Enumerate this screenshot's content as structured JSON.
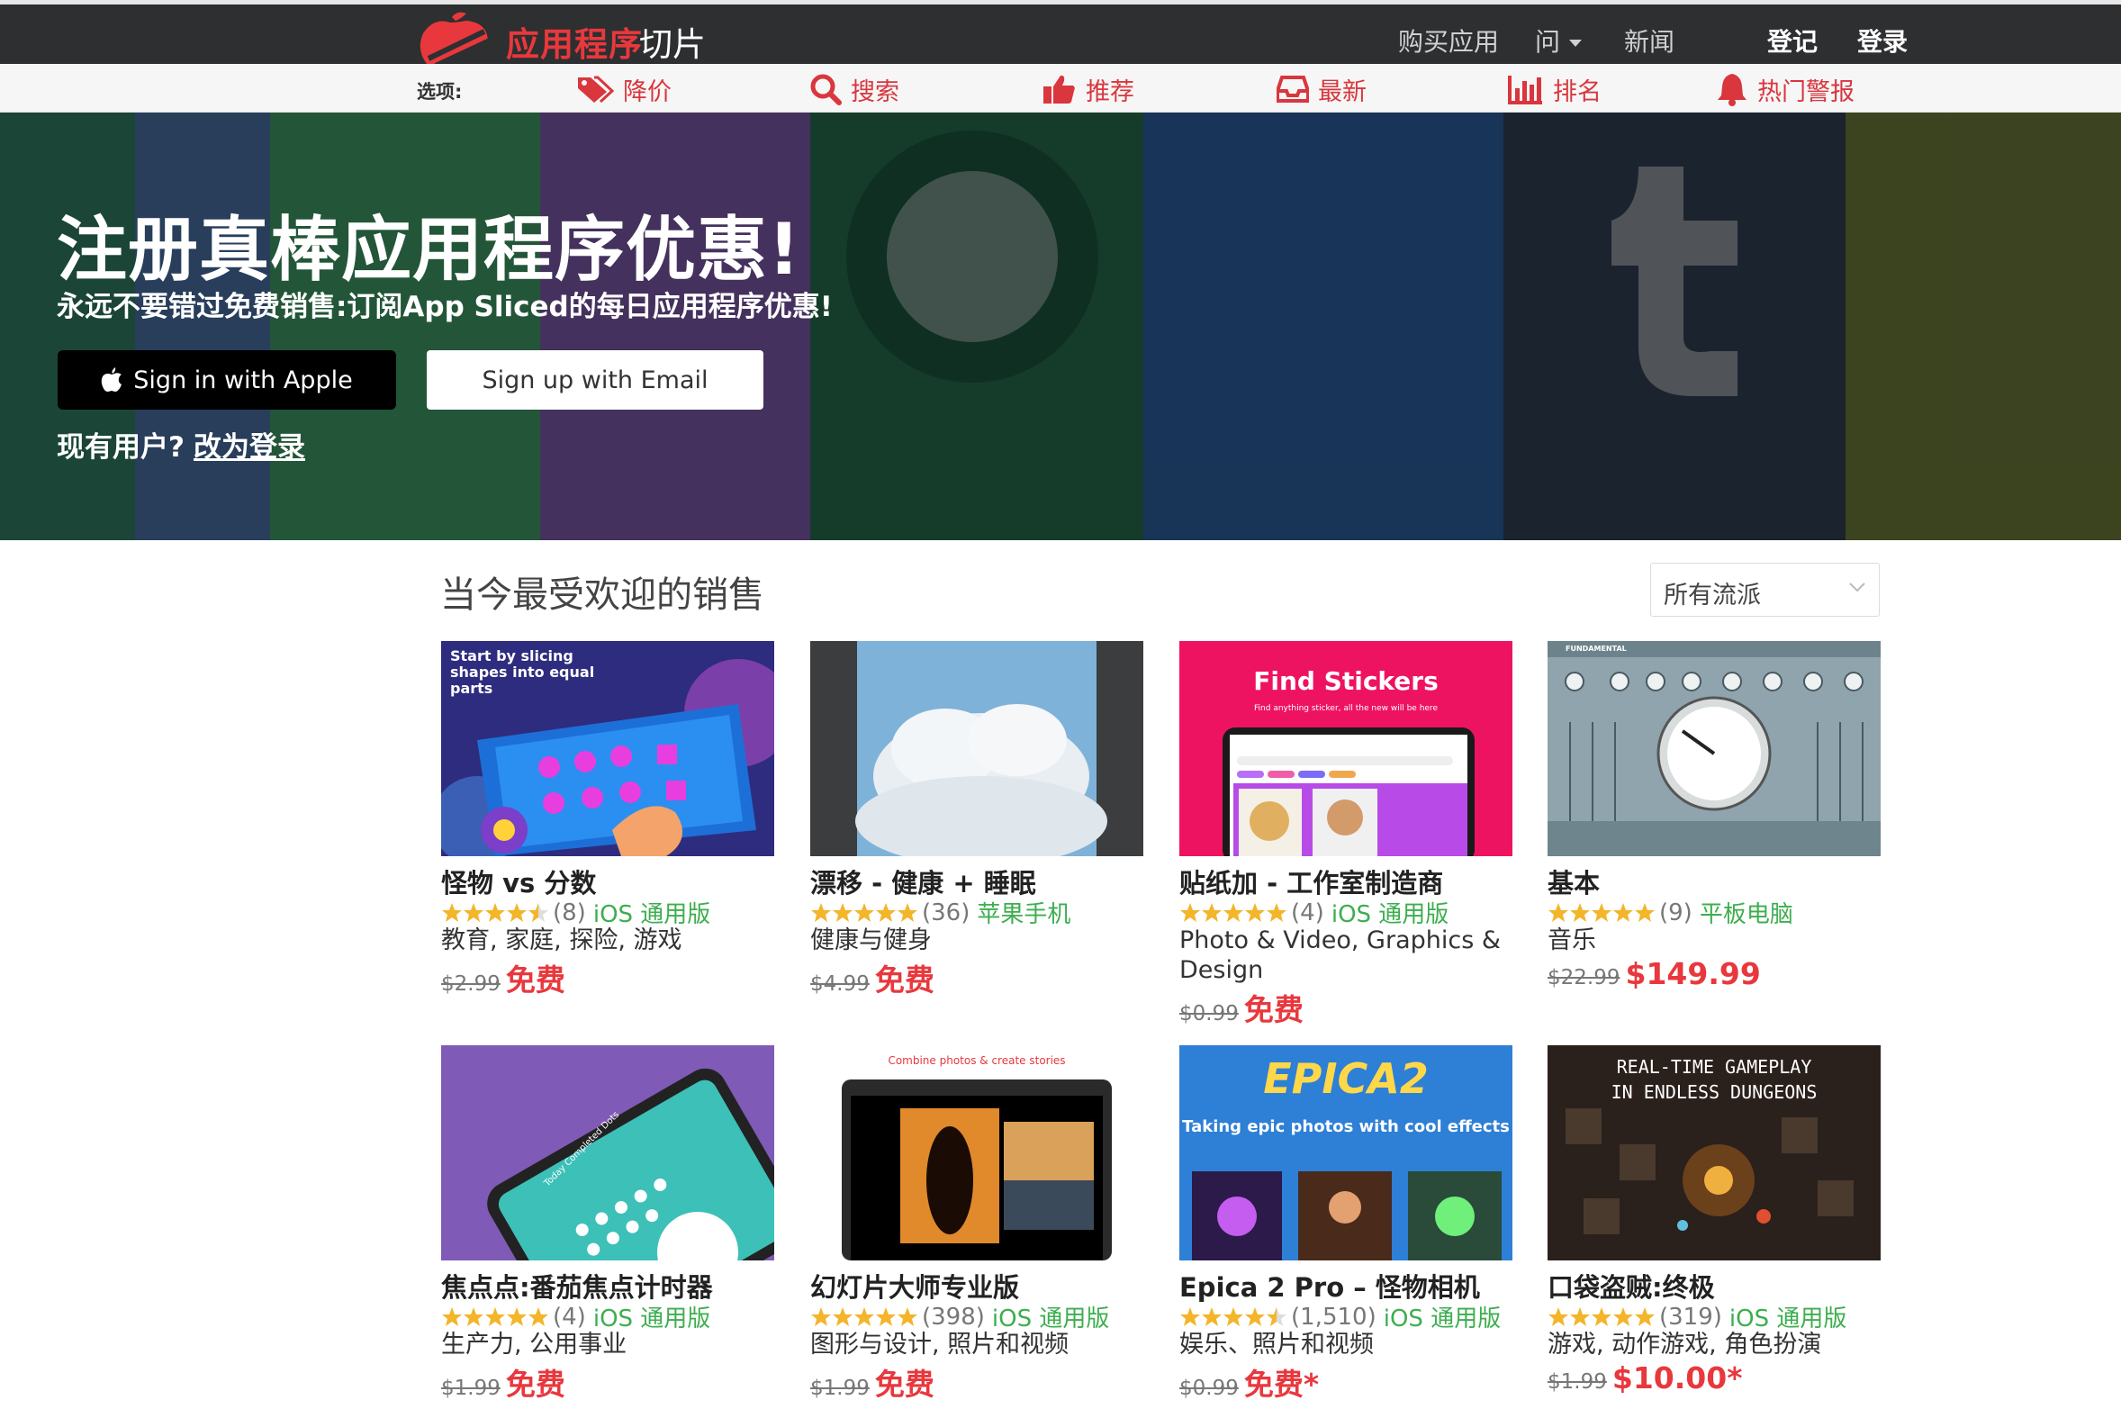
{
  "header": {
    "brand_red": "应用程序",
    "brand_white": "切片",
    "nav": {
      "buy": "购买应用",
      "ask": "问",
      "news": "新闻",
      "register": "登记",
      "login": "登录"
    }
  },
  "options": {
    "label": "选项:",
    "items": [
      {
        "label": "降价",
        "icon": "price-tag-icon"
      },
      {
        "label": "搜索",
        "icon": "search-icon"
      },
      {
        "label": "推荐",
        "icon": "thumbs-up-icon"
      },
      {
        "label": "最新",
        "icon": "inbox-icon"
      },
      {
        "label": "排名",
        "icon": "bar-chart-icon"
      },
      {
        "label": "热门警报",
        "icon": "bell-icon"
      }
    ]
  },
  "hero": {
    "title": "注册真棒应用程序优惠!",
    "subtitle": "永远不要错过免费销售:订阅App Sliced的每日应用程序优惠!",
    "apple_button": "Sign in with Apple",
    "email_button": "Sign up with Email",
    "existing_user": "现有用户?",
    "login_instead": "改为登录"
  },
  "section": {
    "title": "当今最受欢迎的销售",
    "genre_select": "所有流派"
  },
  "apps": [
    {
      "name": "怪物 vs 分数",
      "rating_count": "(8)",
      "platform": "iOS 通用版",
      "categories": "教育, 家庭, 探险, 游戏",
      "old_price": "$2.99",
      "new_price": "免费",
      "stars": 4.5
    },
    {
      "name": "漂移 - 健康 + 睡眠",
      "rating_count": "(36)",
      "platform": "苹果手机",
      "categories": "健康与健身",
      "old_price": "$4.99",
      "new_price": "免费",
      "stars": 5
    },
    {
      "name": "贴纸加 - 工作室制造商",
      "rating_count": "(4)",
      "platform": "iOS 通用版",
      "categories": "Photo & Video, Graphics & Design",
      "old_price": "$0.99",
      "new_price": "免费",
      "stars": 5
    },
    {
      "name": "基本",
      "rating_count": "(9)",
      "platform": "平板电脑",
      "categories": "音乐",
      "old_price": "$22.99",
      "new_price": "$149.99",
      "stars": 5
    },
    {
      "name": "焦点点:番茄焦点计时器",
      "rating_count": "(4)",
      "platform": "iOS 通用版",
      "categories": "生产力, 公用事业",
      "old_price": "$1.99",
      "new_price": "免费",
      "stars": 5
    },
    {
      "name": "幻灯片大师专业版",
      "rating_count": "(398)",
      "platform": "iOS 通用版",
      "categories": "图形与设计, 照片和视频",
      "old_price": "$1.99",
      "new_price": "免费",
      "stars": 5
    },
    {
      "name": "Epica 2 Pro – 怪物相机",
      "rating_count": "(1,510)",
      "platform": "iOS 通用版",
      "categories": "娱乐、照片和视频",
      "old_price": "$0.99",
      "new_price": "免费*",
      "stars": 4.5
    },
    {
      "name": "口袋盗贼:终极",
      "rating_count": "(319)",
      "platform": "iOS 通用版",
      "categories": "游戏, 动作游戏, 角色扮演",
      "old_price": "$1.99",
      "new_price": "$10.00*",
      "stars": 5
    }
  ],
  "thumb_text": {
    "monsters": "Start by slicing shapes into equal parts",
    "stickers": "Find Stickers",
    "stickers_sub": "Find anything sticker, all the new will be here",
    "fundamental": "FUNDAMENTAL",
    "focus": "Today Completed Dots",
    "slideshow": "Combine photos & create stories",
    "epica_logo": "EPICA2",
    "epica": "Taking epic photos with cool effects",
    "rogue1": "REAL-TIME GAMEPLAY",
    "rogue2": "IN ENDLESS DUNGEONS"
  },
  "colors": {
    "accent_red": "#e8383d",
    "nav_bg": "#2d2f31",
    "platform_green": "#3dae4f",
    "star_gold": "#f3b52a"
  }
}
